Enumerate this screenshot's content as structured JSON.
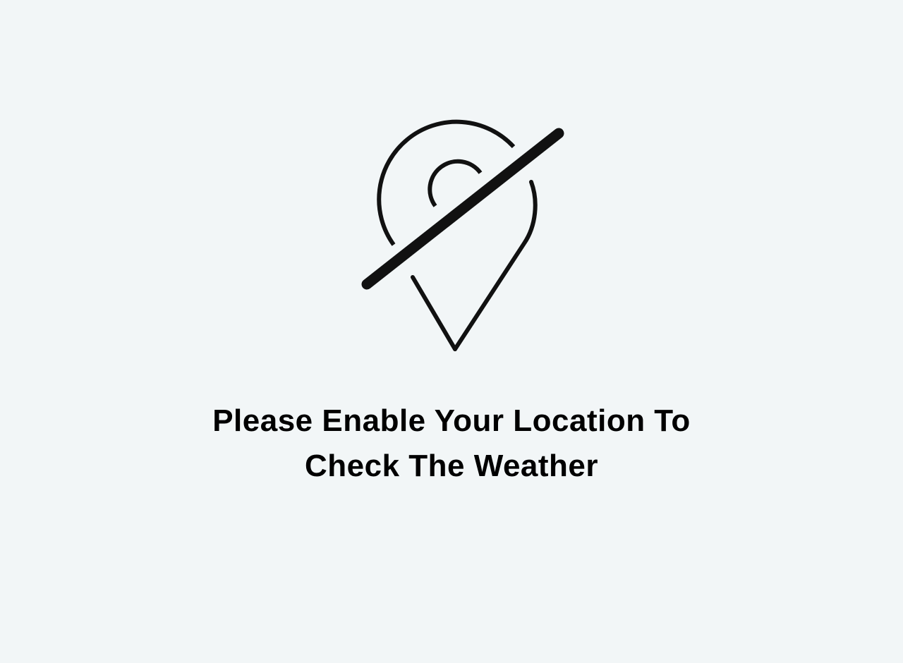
{
  "screen": {
    "icon": "location-off-icon",
    "message_line1": "Please Enable Your Location To",
    "message_line2": "Check The Weather"
  },
  "colors": {
    "background": "#f2f6f7",
    "foreground": "#111111"
  }
}
